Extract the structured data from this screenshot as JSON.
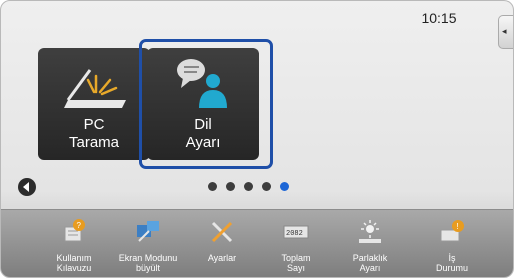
{
  "status": {
    "time": "10:15"
  },
  "side_tab": {
    "glyph": "◂"
  },
  "tiles": [
    {
      "line1": "PC",
      "line2": "Tarama",
      "icon": "scanner-icon",
      "selected": false
    },
    {
      "line1": "Dil",
      "line2": "Ayarı",
      "icon": "language-person-icon",
      "selected": true
    }
  ],
  "pager": {
    "pages": 5,
    "current_page": 5,
    "accent": "#1d66d6"
  },
  "bottom_bar": {
    "items": [
      {
        "line1": "Kullanım",
        "line2": "Kılavuzu",
        "icon": "manual-icon"
      },
      {
        "line1": "Ekran Modunu",
        "line2": "büyült",
        "icon": "magnify-screen-icon"
      },
      {
        "line1": "Ayarlar",
        "line2": "",
        "icon": "tools-icon"
      },
      {
        "line1": "Toplam",
        "line2": "Sayı",
        "icon": "counter-icon"
      },
      {
        "line1": "Parlaklık",
        "line2": "Ayarı",
        "icon": "brightness-icon"
      },
      {
        "line1": "İş",
        "line2": "Durumu",
        "icon": "job-status-icon"
      }
    ]
  },
  "colors": {
    "selection_ring": "#1f4fa8",
    "tile_bg": "#2f2f2f"
  }
}
